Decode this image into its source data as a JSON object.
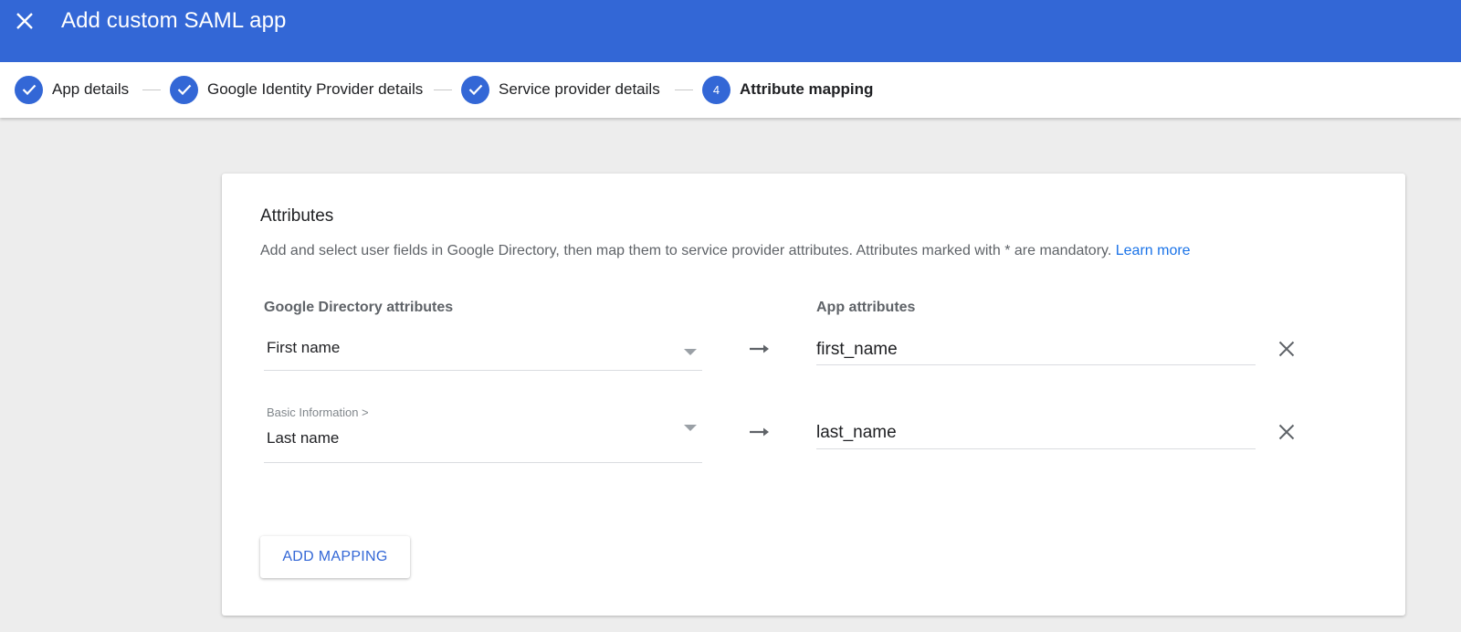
{
  "header": {
    "title": "Add custom SAML app",
    "close_icon": "close-icon",
    "color": "#3367d6"
  },
  "stepper": {
    "steps": [
      {
        "label": "App details",
        "state": "done",
        "icon": "check-icon"
      },
      {
        "label": "Google Identity Provider details",
        "state": "done",
        "icon": "check-icon"
      },
      {
        "label": "Service provider details",
        "state": "done",
        "icon": "check-icon"
      },
      {
        "label": "Attribute mapping",
        "state": "active",
        "number": "4"
      }
    ]
  },
  "attributes": {
    "title": "Attributes",
    "description": "Add and select user fields in Google Directory, then map them to service provider attributes. Attributes marked with * are mandatory.",
    "learn_more": "Learn more",
    "col_directory": "Google Directory attributes",
    "col_app": "App attributes",
    "mappings": [
      {
        "category": "",
        "directory_attr": "First name",
        "app_attr": "first_name"
      },
      {
        "category": "Basic Information >",
        "directory_attr": "Last name",
        "app_attr": "last_name"
      }
    ],
    "add_button": "ADD MAPPING"
  },
  "colors": {
    "accent": "#3367d6",
    "link": "#1a73e8",
    "background": "#ededed"
  }
}
